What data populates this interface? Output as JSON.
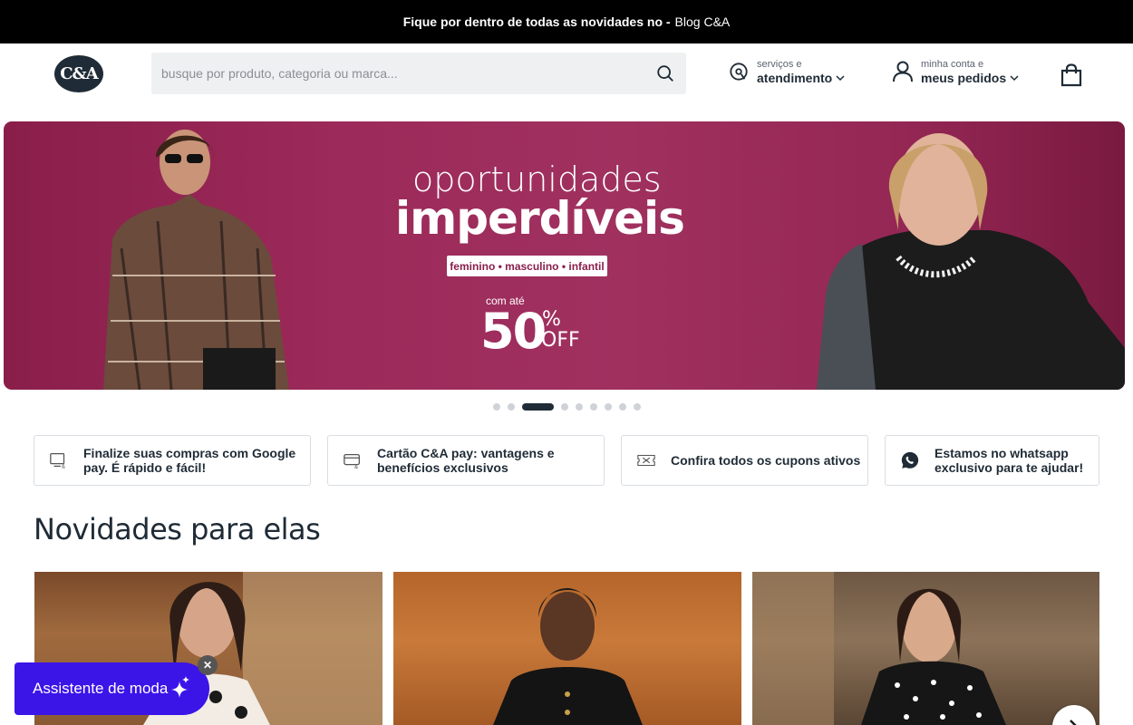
{
  "topbar": {
    "text": "Fique por dentro de todas as novidades no -",
    "link": "Blog C&A"
  },
  "header": {
    "logo": "C&A",
    "search_placeholder": "busque por produto, categoria ou marca...",
    "services_small": "serviços e",
    "services_big": "atendimento",
    "account_small": "minha conta e",
    "account_big": "meus pedidos"
  },
  "hero": {
    "line1": "oportunidades",
    "line2": "imperdíveis",
    "categories": "feminino • masculino • infantil",
    "up_to": "com até",
    "percent": "50",
    "percent_symbol": "%",
    "off": "OFF",
    "slide_count": 9,
    "active_slide": 3
  },
  "cards": [
    {
      "label": "Finalize suas compras com Google pay. É rápido e fácil!",
      "icon": "google-pay-icon"
    },
    {
      "label": "Cartão C&A pay: vantagens e benefícios exclusivos",
      "icon": "credit-card-icon"
    },
    {
      "label": "Confira todos os cupons ativos",
      "icon": "coupon-icon"
    },
    {
      "label": "Estamos no whatsapp exclusivo para te ajudar!",
      "icon": "whatsapp-icon"
    }
  ],
  "section": {
    "title": "Novidades para elas"
  },
  "assistant": {
    "label": "Assistente de moda",
    "close": "✕"
  },
  "colors": {
    "topbar": "#000000",
    "brand_dark": "#1f2b36",
    "hero": "#9c2a5a",
    "assistant": "#3b14e8"
  }
}
